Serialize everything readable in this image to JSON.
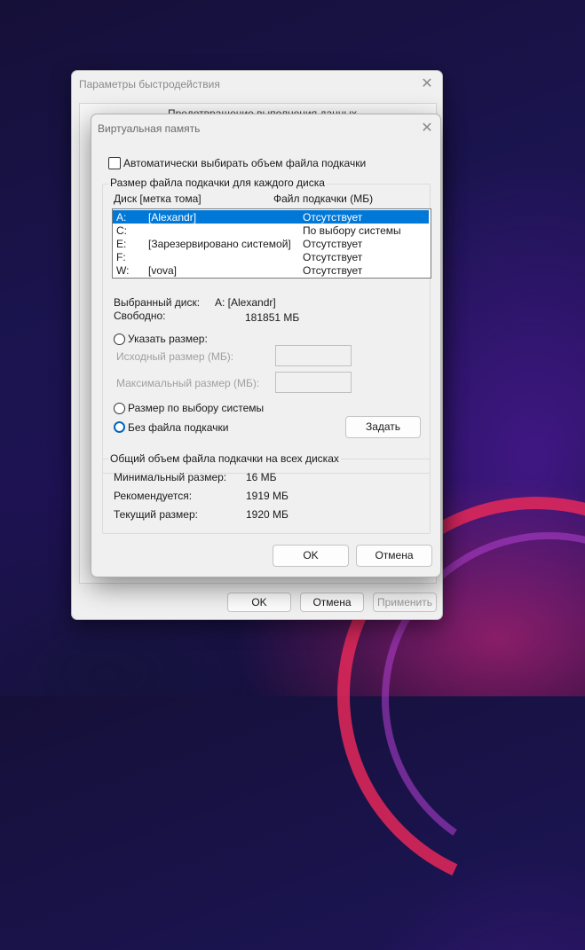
{
  "back_dialog": {
    "title": "Параметры быстродействия",
    "tab_label": "Предотвращение выполнения данных",
    "ok_label": "OK",
    "cancel_label": "Отмена",
    "apply_label": "Применить"
  },
  "dialog": {
    "title": "Виртуальная память",
    "auto_checkbox_label": "Автоматически выбирать объем файла подкачки",
    "auto_checked": false,
    "per_disk_group_title": "Размер файла подкачки для каждого диска",
    "col_disk": "Диск [метка тома]",
    "col_pagefile": "Файл подкачки (МБ)",
    "drives": [
      {
        "letter": "A:",
        "label": "[Alexandr]",
        "pagefile": "Отсутствует",
        "selected": true
      },
      {
        "letter": "C:",
        "label": "",
        "pagefile": "По выбору системы",
        "selected": false
      },
      {
        "letter": "E:",
        "label": "[Зарезервировано системой]",
        "pagefile": "Отсутствует",
        "selected": false
      },
      {
        "letter": "F:",
        "label": "",
        "pagefile": "Отсутствует",
        "selected": false
      },
      {
        "letter": "W:",
        "label": "[vova]",
        "pagefile": "Отсутствует",
        "selected": false
      }
    ],
    "selected_disk_label": "Выбранный диск:",
    "selected_disk_value": "A:  [Alexandr]",
    "free_label": "Свободно:",
    "free_value": "181851 МБ",
    "custom_size_label": "Указать размер:",
    "initial_size_label": "Исходный размер (МБ):",
    "initial_size_value": "",
    "max_size_label": "Максимальный размер (МБ):",
    "max_size_value": "",
    "system_managed_label": "Размер по выбору системы",
    "no_pagefile_label": "Без файла подкачки",
    "selected_option": "no_pagefile",
    "set_button_label": "Задать",
    "totals_group_title": "Общий объем файла подкачки на всех дисках",
    "min_label": "Минимальный размер:",
    "min_value": "16 МБ",
    "recommended_label": "Рекомендуется:",
    "recommended_value": "1919 МБ",
    "current_label": "Текущий размер:",
    "current_value": "1920 МБ",
    "ok_label": "OK",
    "cancel_label": "Отмена"
  },
  "colors": {
    "selection": "#0078d7",
    "radio_accent": "#0067c0"
  }
}
